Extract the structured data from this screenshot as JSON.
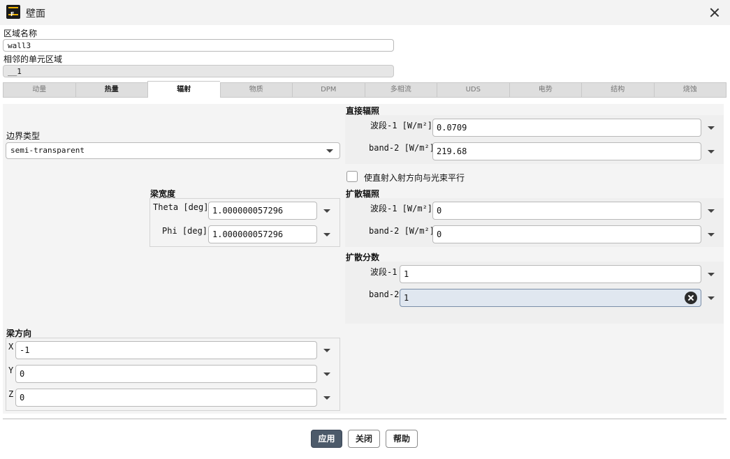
{
  "window": {
    "title": "壁面"
  },
  "zone": {
    "name_label": "区域名称",
    "name_value": "wall3",
    "adjacent_label": "相邻的单元区域",
    "adjacent_value": "__1"
  },
  "tabs": [
    {
      "label": "动量"
    },
    {
      "label": "热量"
    },
    {
      "label": "辐射"
    },
    {
      "label": "物质"
    },
    {
      "label": "DPM"
    },
    {
      "label": "多相流"
    },
    {
      "label": "UDS"
    },
    {
      "label": "电势"
    },
    {
      "label": "结构"
    },
    {
      "label": "烧蚀"
    }
  ],
  "boundary_type": {
    "label": "边界类型",
    "value": "semi-transparent"
  },
  "beam_width": {
    "title": "梁宽度",
    "theta_label": "Theta [deg]",
    "theta_value": "1.000000057296",
    "phi_label": "Phi [deg]",
    "phi_value": "1.000000057296"
  },
  "beam_direction": {
    "title": "梁方向",
    "x_label": "X",
    "x_value": "-1",
    "y_label": "Y",
    "y_value": "0",
    "z_label": "Z",
    "z_value": "0"
  },
  "direct_irradiation": {
    "title": "直接辐照",
    "band1_label": "波段-1 [W/m²]",
    "band1_value": "0.0709",
    "band2_label": "band-2 [W/m²]",
    "band2_value": "219.68"
  },
  "parallel_beam": {
    "label": "使直射入射方向与光束平行",
    "checked": false
  },
  "diffuse_irradiation": {
    "title": "扩散辐照",
    "band1_label": "波段-1 [W/m²]",
    "band1_value": "0",
    "band2_label": "band-2 [W/m²]",
    "band2_value": "0"
  },
  "diffuse_fraction": {
    "title": "扩散分数",
    "band1_label": "波段-1",
    "band1_value": "1",
    "band2_label": "band-2",
    "band2_value": "1"
  },
  "buttons": {
    "apply": "应用",
    "close": "关闭",
    "help": "帮助"
  },
  "colors": {
    "primary_button": "#4c5a6a",
    "focused_field": "#e0e7f0"
  }
}
